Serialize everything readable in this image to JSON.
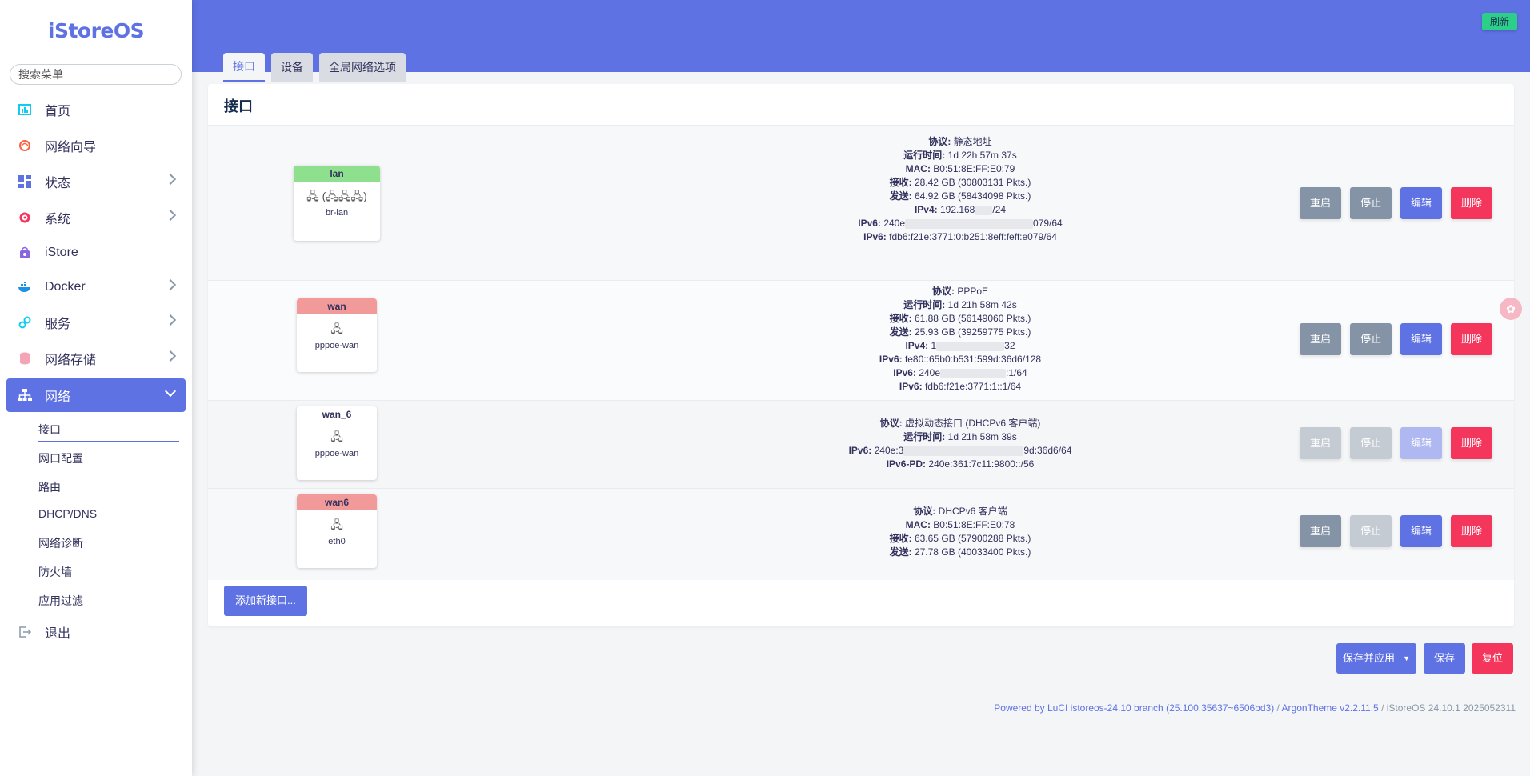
{
  "sidebar": {
    "logo": "iStoreOS",
    "search_placeholder": "搜索菜单",
    "items": [
      {
        "label": "首页"
      },
      {
        "label": "网络向导"
      },
      {
        "label": "状态"
      },
      {
        "label": "系统"
      },
      {
        "label": "iStore"
      },
      {
        "label": "Docker"
      },
      {
        "label": "服务"
      },
      {
        "label": "网络存储"
      },
      {
        "label": "网络"
      },
      {
        "label": "退出"
      }
    ],
    "subitems": [
      {
        "label": "接口"
      },
      {
        "label": "网口配置"
      },
      {
        "label": "路由"
      },
      {
        "label": "DHCP/DNS"
      },
      {
        "label": "网络诊断"
      },
      {
        "label": "防火墙"
      },
      {
        "label": "应用过滤"
      }
    ]
  },
  "header": {
    "refresh_label": "刷新",
    "tabs": [
      {
        "label": "接口"
      },
      {
        "label": "设备"
      },
      {
        "label": "全局网络选项"
      }
    ]
  },
  "card": {
    "title": "接口",
    "buttons": {
      "restart": "重启",
      "stop": "停止",
      "edit": "编辑",
      "delete": "删除"
    },
    "add_label": "添加新接口..."
  },
  "interfaces": [
    {
      "name": "lan",
      "color": "#8ee08e",
      "icons": "🖧 (🖧🖧🖧)",
      "device": "br-lan",
      "protocol": "静态地址",
      "uptime": "1d 22h 57m 37s",
      "mac": "B0:51:8E:FF:E0:79",
      "rx": "28.42 GB (30803131 Pkts.)",
      "tx": "64.92 GB (58434098 Pkts.)",
      "ipv4_a": "192.168",
      "ipv4_b": "/24",
      "ipv6_a": "240e",
      "ipv6_b": "079/64",
      "ipv6_2": "fdb6:f21e:3771:0:b251:8eff:feff:e079/64"
    },
    {
      "name": "wan",
      "color": "#f29a9a",
      "icons": "🖧",
      "device": "pppoe-wan",
      "protocol": "PPPoE",
      "uptime": "1d 21h 58m 42s",
      "rx": "61.88 GB (56149060 Pkts.)",
      "tx": "25.93 GB (39259775 Pkts.)",
      "ipv4_a": "1",
      "ipv4_b": "32",
      "ipv6_1": "fe80::65b0:b531:599d:36d6/128",
      "ipv6_2a": "240e",
      "ipv6_2b": ":1/64",
      "ipv6_3": "fdb6:f21e:3771:1::1/64"
    },
    {
      "name": "wan_6",
      "color": "#ffffff",
      "icons": "🖧",
      "device": "pppoe-wan",
      "protocol": "虚拟动态接口 (DHCPv6 客户端)",
      "uptime": "1d 21h 58m 39s",
      "ipv6_a": "240e:3",
      "ipv6_b": "9d:36d6/64",
      "ipv6pd": "240e:361:7c11:9800::/56"
    },
    {
      "name": "wan6",
      "color": "#f29a9a",
      "icons": "🖧",
      "device": "eth0",
      "protocol": "DHCPv6 客户端",
      "mac": "B0:51:8E:FF:E0:78",
      "rx": "63.65 GB (57900288 Pkts.)",
      "tx": "27.78 GB (40033400 Pkts.)"
    }
  ],
  "labels": {
    "protocol": "协议:",
    "uptime": "运行时间:",
    "mac": "MAC:",
    "rx": "接收:",
    "tx": "发送:",
    "ipv4": "IPv4:",
    "ipv6": "IPv6:",
    "ipv6pd": "IPv6-PD:"
  },
  "bottom": {
    "save_apply": "保存并应用",
    "save": "保存",
    "reset": "复位"
  },
  "footer": {
    "luci": "Powered by LuCI istoreos-24.10 branch (25.100.35637~6506bd3)",
    "sep1": " / ",
    "theme": "ArgonTheme v2.2.11.5",
    "sep2": " / ",
    "version": "iStoreOS 24.10.1 2025052311"
  }
}
